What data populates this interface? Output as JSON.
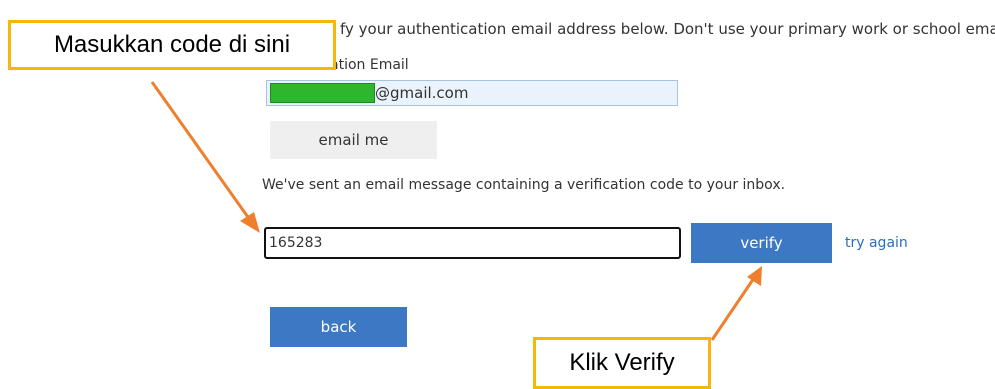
{
  "form": {
    "instructions": "fy your authentication email address below. Don't use your primary work or school email.",
    "email_label": "ation Email",
    "email_value": "@gmail.com",
    "email_me_label": "email me",
    "sent_message": "We've sent an email message containing a verification code to your inbox.",
    "code_value": "165283",
    "verify_label": "verify",
    "try_again_label": "try again",
    "back_label": "back"
  },
  "annotations": {
    "enter_code_callout": "Masukkan code di sini",
    "verify_callout": "Klik Verify"
  },
  "colors": {
    "primary_button": "#3c78c4",
    "callout_border": "#f5b80a",
    "arrow": "#ee7f2d",
    "link": "#2a6fb8",
    "redaction": "#2eb72e"
  },
  "icons": {
    "arrow_to_code": "arrow-icon",
    "arrow_to_verify": "arrow-icon"
  }
}
